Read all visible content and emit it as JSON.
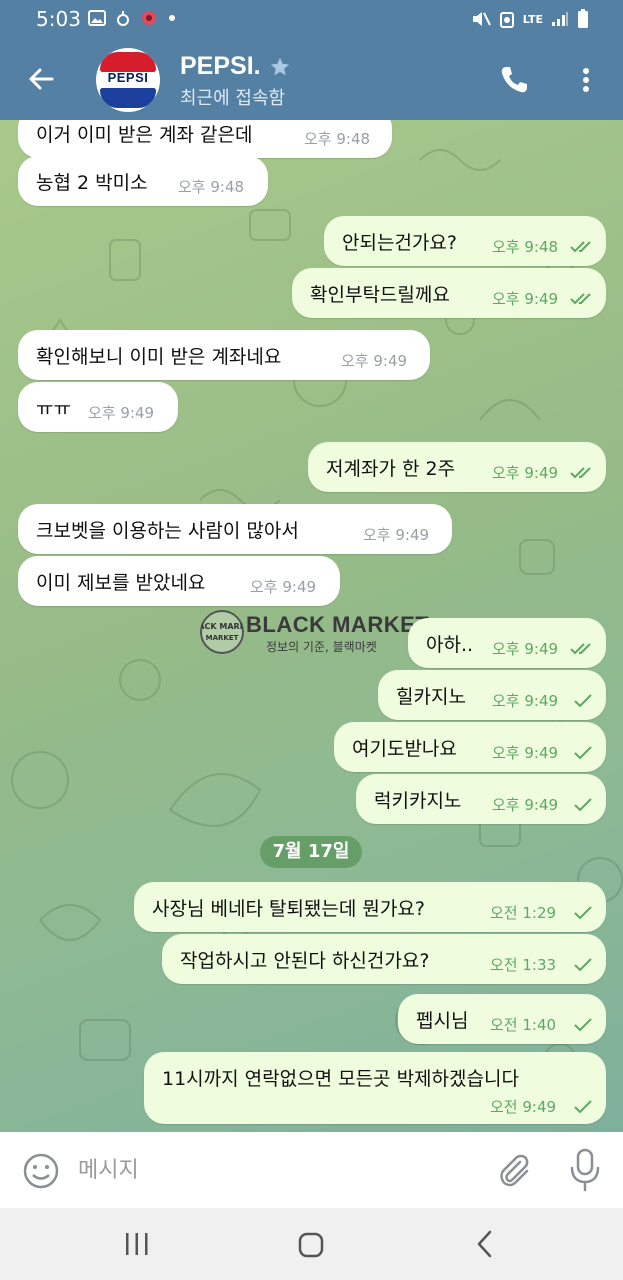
{
  "status_bar": {
    "time": "5:03",
    "network": "LTE",
    "icons_left": [
      "gallery-icon",
      "app-icon",
      "notification-icon",
      "dot-icon"
    ],
    "icons_right": [
      "mute-icon",
      "data-saver-icon",
      "signal-icon",
      "battery-icon"
    ]
  },
  "header": {
    "contact_name": "PEPSI.",
    "avatar_text": "PEPSI",
    "status": "최근에 접속함",
    "icons": [
      "back-arrow-icon",
      "star-icon",
      "phone-icon",
      "more-icon"
    ]
  },
  "messages": [
    {
      "dir": "in",
      "text": "이거 이미 받은 계좌 같은데",
      "time": "오후 9:48"
    },
    {
      "dir": "in",
      "text": "농협 2 박미소",
      "time": "오후 9:48"
    },
    {
      "dir": "out",
      "text": "안되는건가요?",
      "time": "오후 9:48",
      "read": true
    },
    {
      "dir": "out",
      "text": "확인부탁드릴께요",
      "time": "오후 9:49",
      "read": true
    },
    {
      "dir": "in",
      "text": "확인해보니 이미 받은 계좌네요",
      "time": "오후 9:49"
    },
    {
      "dir": "in",
      "text": "ㅠㅠ",
      "time": "오후 9:49"
    },
    {
      "dir": "out",
      "text": "저계좌가 한 2주",
      "time": "오후 9:49",
      "read": true
    },
    {
      "dir": "in",
      "text": "크보벳을 이용하는 사람이 많아서",
      "time": "오후 9:49"
    },
    {
      "dir": "in",
      "text": "이미 제보를 받았네요",
      "time": "오후 9:49"
    },
    {
      "dir": "out",
      "text": "아하..",
      "time": "오후 9:49",
      "read": true
    },
    {
      "dir": "out",
      "text": "힐카지노",
      "time": "오후 9:49",
      "read": false
    },
    {
      "dir": "out",
      "text": "여기도받나요",
      "time": "오후 9:49",
      "read": false
    },
    {
      "dir": "out",
      "text": "럭키카지노",
      "time": "오후 9:49",
      "read": false
    },
    {
      "dir": "out",
      "text": "사장님 베네타 탈퇴됐는데 뭔가요?",
      "time": "오전 1:29",
      "read": false
    },
    {
      "dir": "out",
      "text": "작업하시고 안된다 하신건가요?",
      "time": "오전 1:33",
      "read": false
    },
    {
      "dir": "out",
      "text": "펩시님",
      "time": "오전 1:40",
      "read": false
    },
    {
      "dir": "out",
      "text": "11시까지 연락없으면 모든곳 박제하겠습니다",
      "time": "오전 9:49",
      "read": false
    }
  ],
  "date_separator": "7월 17일",
  "watermark": {
    "logo_text": "BLACK MARKET",
    "title": "BLACK MARKET",
    "subtitle": "정보의 기준, 블랙마켓"
  },
  "input_bar": {
    "placeholder": "메시지",
    "value": ""
  },
  "nav_bar": {
    "icons": [
      "recent-apps-icon",
      "home-icon",
      "back-icon"
    ]
  },
  "colors": {
    "header": "#5480a3",
    "bubble_in": "#ffffff",
    "bubble_out": "#effdde",
    "time_out": "#5fa864",
    "time_in": "#9aa0a6",
    "check": "#5fa864"
  }
}
